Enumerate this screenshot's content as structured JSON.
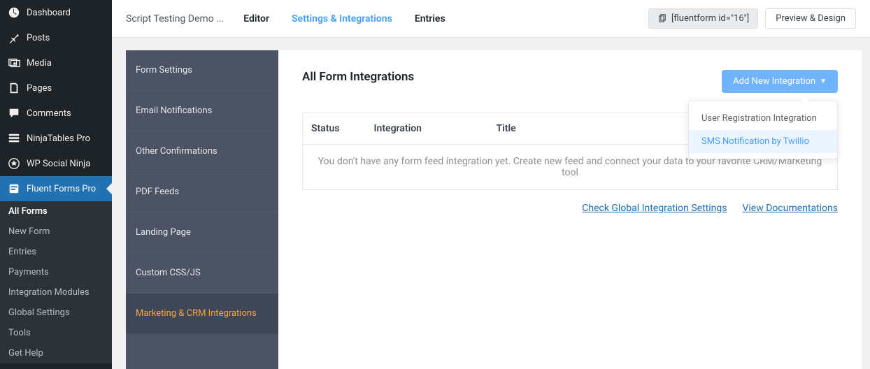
{
  "admin_menu": {
    "dashboard": "Dashboard",
    "posts": "Posts",
    "media": "Media",
    "pages": "Pages",
    "comments": "Comments",
    "ninjatables": "NinjaTables Pro",
    "wpsocial": "WP Social Ninja",
    "fluentforms": "Fluent Forms Pro"
  },
  "fluent_submenu": {
    "all_forms": "All Forms",
    "new_form": "New Form",
    "entries": "Entries",
    "payments": "Payments",
    "integration_modules": "Integration Modules",
    "global_settings": "Global Settings",
    "tools": "Tools",
    "get_help": "Get Help"
  },
  "topbar": {
    "title": "Script Testing Demo ...",
    "tab_editor": "Editor",
    "tab_settings": "Settings & Integrations",
    "tab_entries": "Entries",
    "shortcode": "[fluentform id=\"16\"]",
    "preview": "Preview & Design"
  },
  "settings_nav": {
    "form_settings": "Form Settings",
    "email_notifications": "Email Notifications",
    "other_confirmations": "Other Confirmations",
    "pdf_feeds": "PDF Feeds",
    "landing_page": "Landing Page",
    "custom_css": "Custom CSS/JS",
    "marketing_crm": "Marketing & CRM Integrations"
  },
  "content": {
    "heading": "All Form Integrations",
    "add_btn": "Add New Integration",
    "dropdown": {
      "user_reg": "User Registration Integration",
      "sms_twilio": "SMS Notification by Twillio"
    },
    "table_headers": {
      "status": "Status",
      "integration": "Integration",
      "title": "Title"
    },
    "empty_msg": "You don't have any form feed integration yet. Create new feed and connect your data to your favorite CRM/Marketing tool",
    "link_global": "Check Global Integration Settings",
    "link_docs": "View Documentations"
  }
}
